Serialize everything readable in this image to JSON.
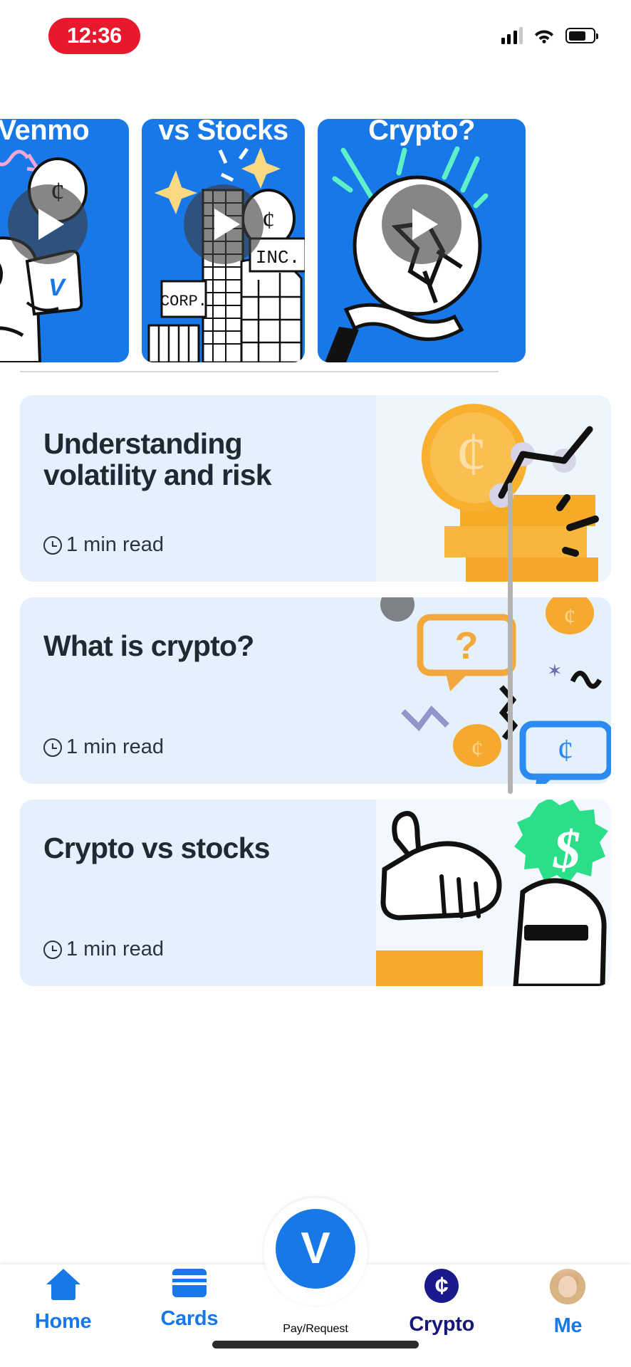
{
  "status_bar": {
    "time": "12:36",
    "time_pill_color": "#e8192c",
    "signal_icon": "cellular-signal-icon",
    "wifi_icon": "wifi-icon",
    "battery_icon": "battery-icon"
  },
  "video_carousel": {
    "cards": [
      {
        "title": "n Venmo",
        "full_title": "Crypto on Venmo",
        "play_icon": "play-icon",
        "bg_color": "#1878e8",
        "art": "person-holding-phone-with-coin"
      },
      {
        "title": "vs Stocks",
        "full_title": "Crypto vs Stocks",
        "play_icon": "play-icon",
        "bg_color": "#1878e8",
        "art": "corp-inc-buildings-with-coin"
      },
      {
        "title": "Crypto?",
        "full_title": "What is Crypto?",
        "play_icon": "play-icon",
        "bg_color": "#1878e8",
        "art": "hand-holding-large-coin"
      }
    ]
  },
  "articles": [
    {
      "title": "Understanding volatility and risk",
      "read_time": "1 min read",
      "clock_icon": "clock-icon",
      "bg_color": "#e4f1fc",
      "art": "gold-coin-stack-with-molecule"
    },
    {
      "title": "What is crypto?",
      "read_time": "1 min read",
      "clock_icon": "clock-icon",
      "bg_color": "#e4f1fc",
      "art": "question-speech-bubble-with-coins"
    },
    {
      "title": "Crypto vs stocks",
      "read_time": "1 min read",
      "clock_icon": "clock-icon",
      "bg_color": "#e4f1fc",
      "art": "hand-pointing-with-green-dollar-badge"
    }
  ],
  "tab_bar": {
    "active_tab": "Crypto",
    "active_color": "#16197a",
    "inactive_color": "#1878e8",
    "tabs": [
      {
        "label": "Home",
        "icon": "home-icon"
      },
      {
        "label": "Cards",
        "icon": "card-icon"
      },
      {
        "label": "Pay/Request",
        "icon": "venmo-v-icon"
      },
      {
        "label": "Crypto",
        "icon": "crypto-coin-icon"
      },
      {
        "label": "Me",
        "icon": "avatar-icon"
      }
    ],
    "center_button_glyph": "V"
  },
  "home_indicator": "home-indicator-bar"
}
